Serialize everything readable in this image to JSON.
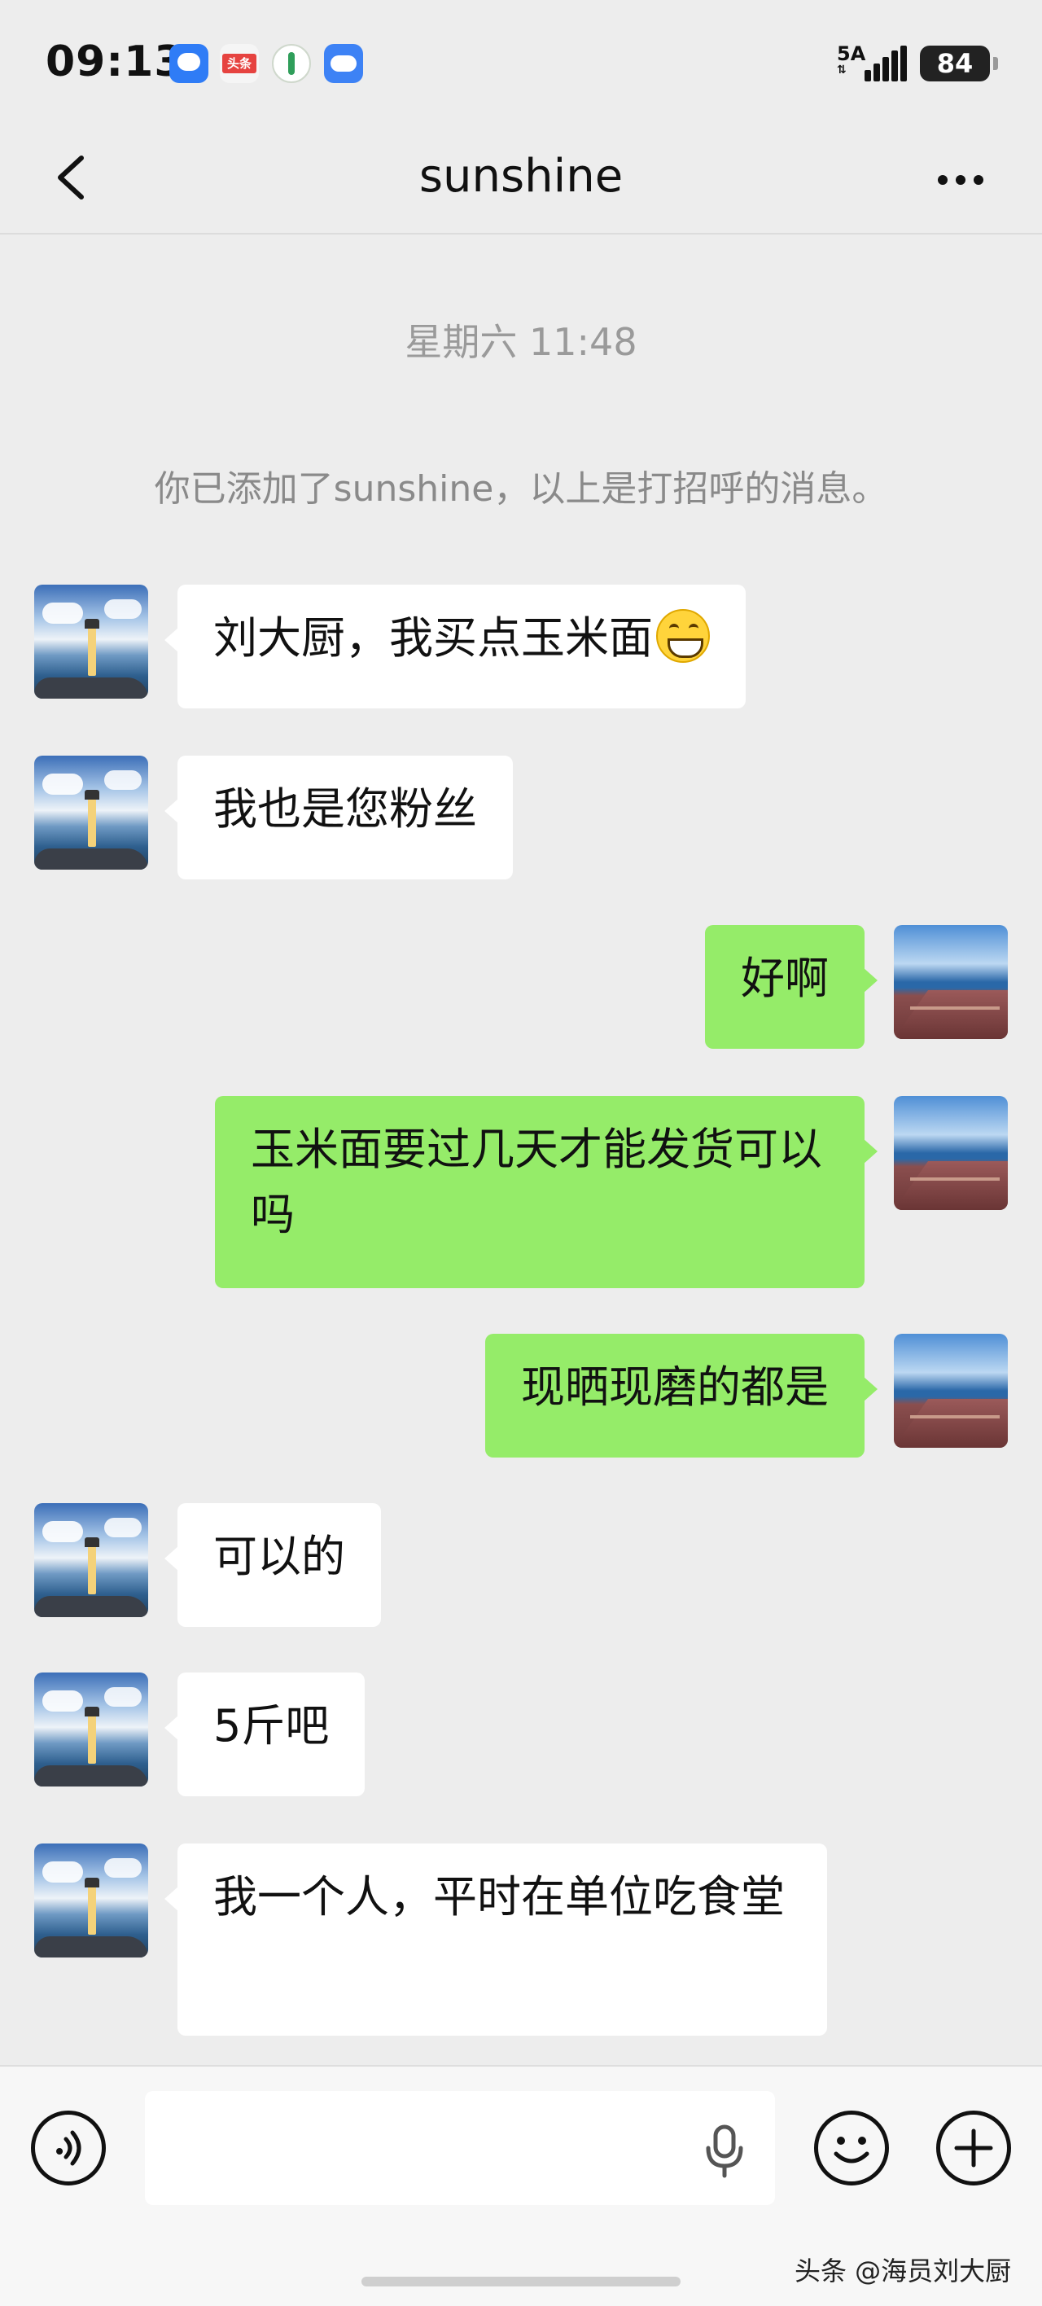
{
  "status_bar": {
    "time": "09:13",
    "network": "5A",
    "battery": "84",
    "app_icons": [
      "message-icon",
      "toutiao-icon",
      "leaf-icon",
      "weather-icon"
    ],
    "toutiao_label": "头条"
  },
  "header": {
    "title": "sunshine",
    "back_icon": "chevron-left-icon",
    "more_icon": "more-dots-icon"
  },
  "chat": {
    "timestamp": "星期六 11:48",
    "system_notice": "你已添加了sunshine，以上是打招呼的消息。",
    "messages": [
      {
        "side": "left",
        "text": "刘大厨，我买点玉米面",
        "emoji": "grinning-face-icon"
      },
      {
        "side": "left",
        "text": "我也是您粉丝"
      },
      {
        "side": "right",
        "text": "好啊"
      },
      {
        "side": "right",
        "text": "玉米面要过几天才能发货可以吗"
      },
      {
        "side": "right",
        "text": "现晒现磨的都是"
      },
      {
        "side": "left",
        "text": "可以的"
      },
      {
        "side": "left",
        "text": "5斤吧"
      },
      {
        "side": "left",
        "text": "我一个人，平时在单位吃食堂"
      }
    ]
  },
  "input_bar": {
    "voice_icon": "voice-icon",
    "mic_icon": "microphone-icon",
    "emoji_icon": "emoji-icon",
    "plus_icon": "plus-icon",
    "input_value": "",
    "input_placeholder": ""
  },
  "watermark": "头条 @海员刘大厨",
  "colors": {
    "background": "#ededed",
    "bubble_sent": "#95ec69",
    "bubble_received": "#ffffff"
  }
}
